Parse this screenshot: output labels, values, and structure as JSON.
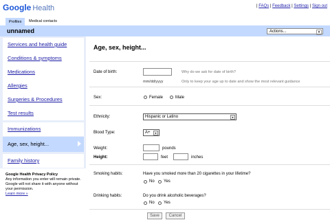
{
  "brand": {
    "logo_google": "Google",
    "logo_health": "Health"
  },
  "toplinks": [
    "FAQs",
    "Feedback",
    "Settings",
    "Sign out"
  ],
  "tabs": [
    "Profiles",
    "Medical contacts"
  ],
  "profile_name": "unnamed",
  "actions_label": "Actions...",
  "sidebar": {
    "items": [
      {
        "label": "Services and health guide"
      },
      {
        "label": "Conditions & symptoms"
      },
      {
        "label": "Medications"
      },
      {
        "label": "Allergies"
      },
      {
        "label": "Surgeries & Procedures"
      },
      {
        "label": "Test results"
      },
      {
        "label": "Immunizations"
      },
      {
        "label": "Age, sex, height..."
      },
      {
        "label": "Family history"
      }
    ]
  },
  "privacy": {
    "title": "Google Health Privacy Policy",
    "body": "Any information you enter will remain private. Google will not share it with anyone without your permission.",
    "link": "Learn more »"
  },
  "main": {
    "title": "Age, sex, height...",
    "dob_label": "Date of birth:",
    "dob_value": "",
    "dob_format": "mm/dd/yyyy",
    "dob_why": "Why do we ask for date of birth?",
    "dob_note": "Only to keep your age up to date and show the most relevant guidance",
    "sex_label": "Sex:",
    "sex_options": [
      "Female",
      "Male"
    ],
    "ethnicity_label": "Ethnicity:",
    "ethnicity_value": "Hispanic or Latino",
    "blood_label": "Blood Type:",
    "blood_value": "A+",
    "weight_label": "Weight:",
    "weight_unit": "pounds",
    "height_label": "Height:",
    "height_feet": "feet",
    "height_inches": "inches",
    "smoking_label": "Smoking habits:",
    "smoking_question": "Have you smoked more than 20 cigarettes in your lifetime?",
    "drinking_label": "Drinking habits:",
    "drinking_question": "Do you drink alcoholic beverages?",
    "yes_no": [
      "No",
      "Yes"
    ],
    "save": "Save",
    "cancel": "Cancel"
  }
}
